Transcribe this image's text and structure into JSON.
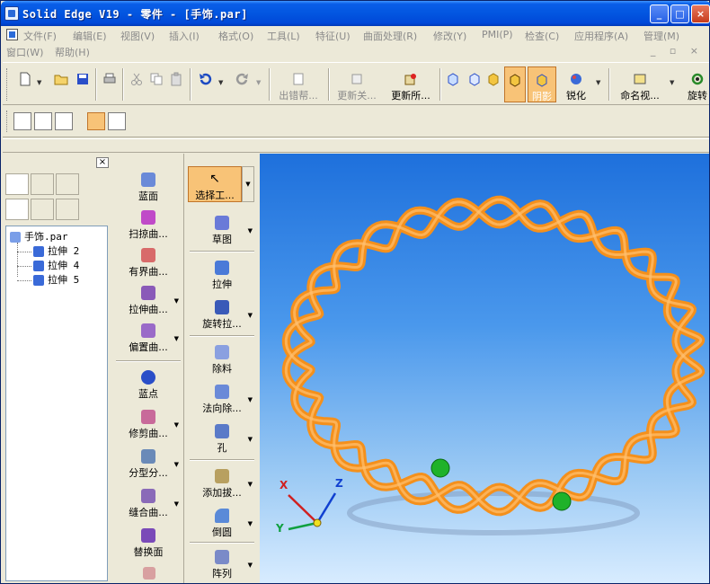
{
  "window": {
    "title": "Solid Edge V19 - 零件 - [手饰.par]",
    "min": "_",
    "max": "□",
    "close": "×"
  },
  "menu": [
    "文件(F)",
    "编辑(E)",
    "视图(V)",
    "插入(I)",
    "格式(O)",
    "工具(L)",
    "特征(U)",
    "曲面处理(R)",
    "修改(Y)",
    "PMI(P)",
    "检查(C)",
    "应用程序(A)",
    "管理(M)"
  ],
  "menu2": [
    "窗口(W)",
    "帮助(H)"
  ],
  "mdi": "_ ▫ ×",
  "toolbar": {
    "error_label": "出错帮...",
    "update_rel_label": "更新关...",
    "update_all_label": "更新所...",
    "shade_label": "阴影",
    "sharpen_label": "锐化",
    "named_view_label": "命名视...",
    "rotate_label": "旋转"
  },
  "tree": {
    "root": "手饰.par",
    "items": [
      "拉伸 2",
      "拉伸 4",
      "拉伸 5"
    ]
  },
  "palette_surfaces": [
    "蓝面",
    "扫掠曲...",
    "有界曲...",
    "拉伸曲...",
    "偏置曲...",
    "蓝点",
    "修剪曲...",
    "分型分...",
    "缝合曲...",
    "替换面"
  ],
  "palette_features": [
    "选择工...",
    "草图",
    "拉伸",
    "旋转拉...",
    "除料",
    "法向除...",
    "孔",
    "添加拔...",
    "倒圆",
    "阵列"
  ],
  "axes": {
    "x": "X",
    "y": "Y",
    "z": "Z"
  },
  "colors": {
    "ring": "#f4901c",
    "marker": "#1fb22a",
    "highlight": "#f8c377"
  }
}
